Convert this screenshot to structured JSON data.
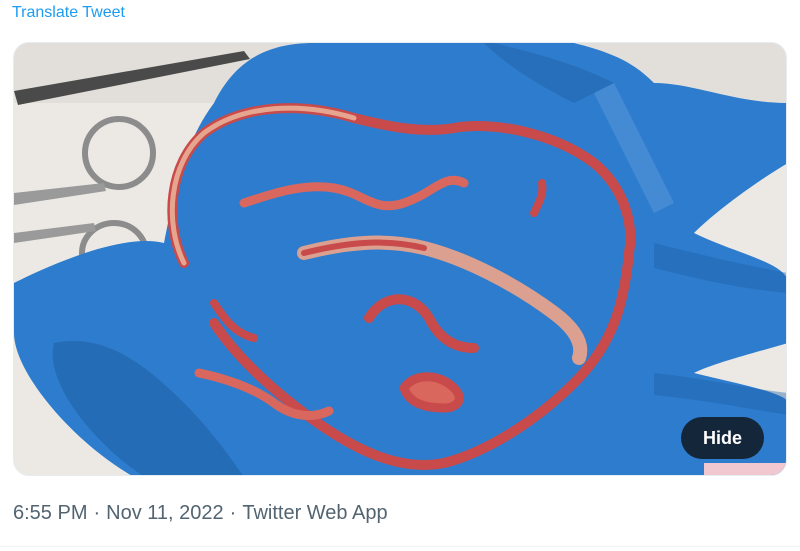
{
  "tweet": {
    "translate_label": "Translate Tweet",
    "media": {
      "hide_label": "Hide",
      "colors": {
        "glove": "#2f7fd0",
        "glove_shadow": "#1f5fa6",
        "background": "#e9e6e2",
        "tissue": "#c94a4a",
        "tissue_light": "#e6a58f"
      }
    },
    "meta": {
      "time": "6:55 PM",
      "separator": "·",
      "date": "Nov 11, 2022",
      "source": "Twitter Web App"
    }
  }
}
